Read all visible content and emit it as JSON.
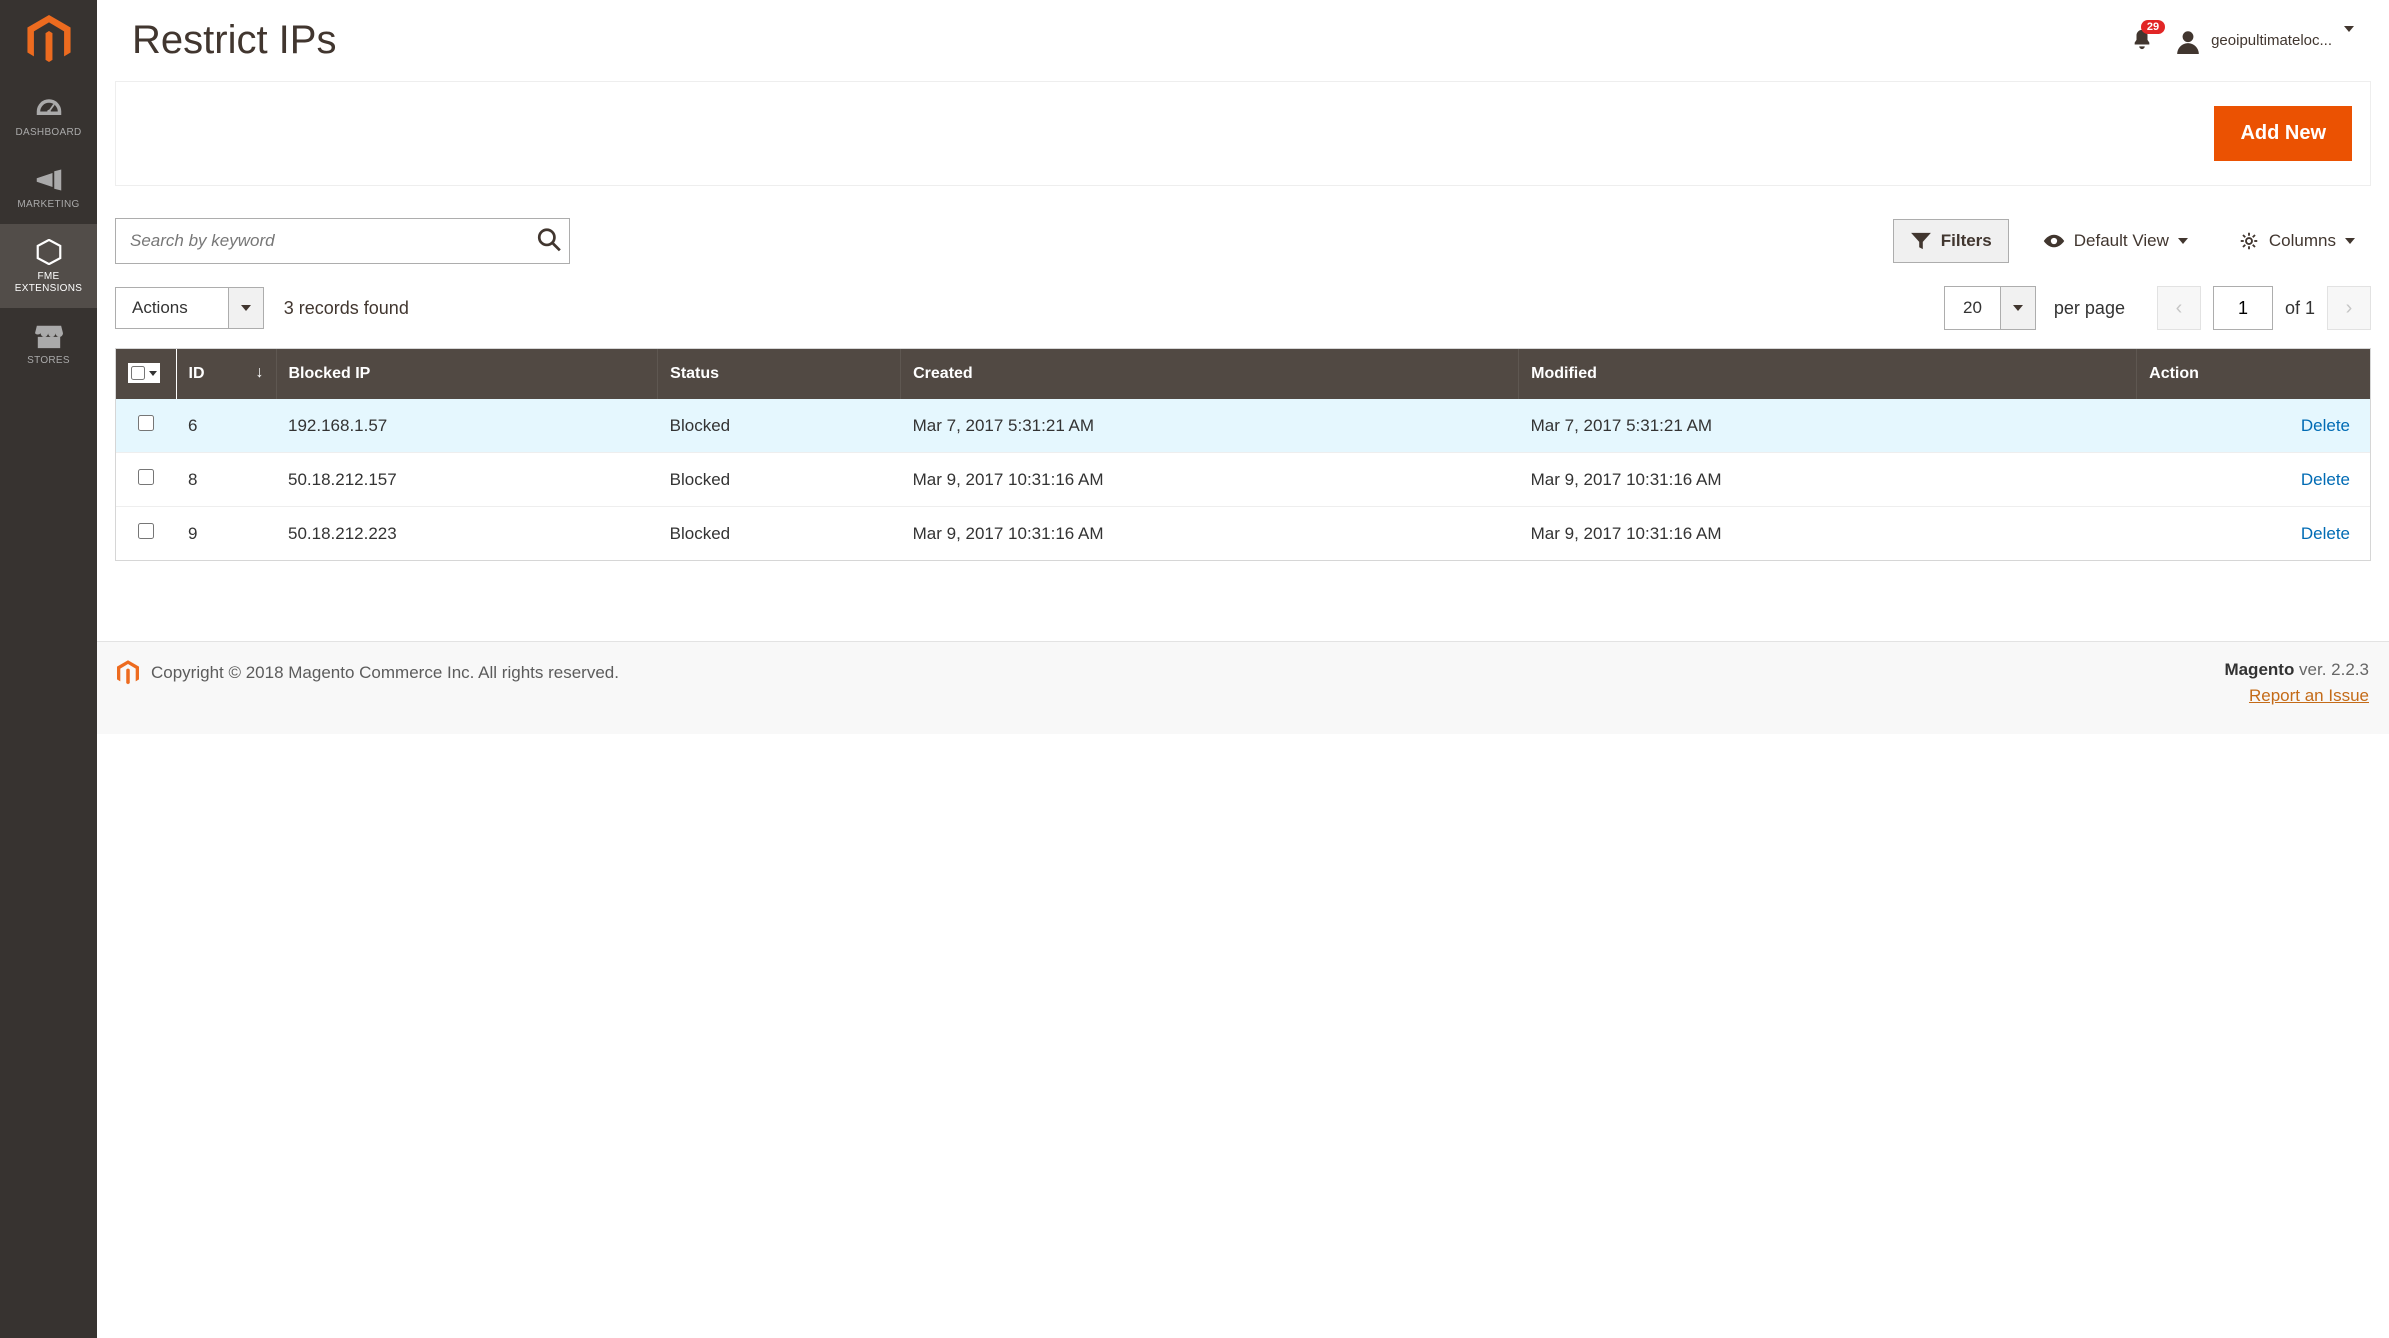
{
  "page": {
    "title": "Restrict IPs"
  },
  "notifications": {
    "count": "29"
  },
  "user": {
    "name": "geoipultimateloc..."
  },
  "sidebar": {
    "items": [
      {
        "label": "DASHBOARD"
      },
      {
        "label": "MARKETING"
      },
      {
        "label": "FME EXTENSIONS"
      },
      {
        "label": "STORES"
      }
    ]
  },
  "actions": {
    "add_new": "Add New",
    "actions_label": "Actions"
  },
  "search": {
    "placeholder": "Search by keyword"
  },
  "controls": {
    "filters": "Filters",
    "default_view": "Default View",
    "columns": "Columns"
  },
  "records_found": "3 records found",
  "pagination": {
    "per_page_value": "20",
    "per_page_label": "per page",
    "current": "1",
    "of_label": "of 1"
  },
  "columns": {
    "id": "ID",
    "blocked_ip": "Blocked IP",
    "status": "Status",
    "created": "Created",
    "modified": "Modified",
    "action": "Action"
  },
  "rows": [
    {
      "id": "6",
      "ip": "192.168.1.57",
      "status": "Blocked",
      "created": "Mar 7, 2017 5:31:21 AM",
      "modified": "Mar 7, 2017 5:31:21 AM",
      "action": "Delete"
    },
    {
      "id": "8",
      "ip": "50.18.212.157",
      "status": "Blocked",
      "created": "Mar 9, 2017 10:31:16 AM",
      "modified": "Mar 9, 2017 10:31:16 AM",
      "action": "Delete"
    },
    {
      "id": "9",
      "ip": "50.18.212.223",
      "status": "Blocked",
      "created": "Mar 9, 2017 10:31:16 AM",
      "modified": "Mar 9, 2017 10:31:16 AM",
      "action": "Delete"
    }
  ],
  "footer": {
    "copyright": "Copyright © 2018 Magento Commerce Inc. All rights reserved.",
    "brand": "Magento",
    "version": " ver. 2.2.3",
    "report": "Report an Issue"
  }
}
